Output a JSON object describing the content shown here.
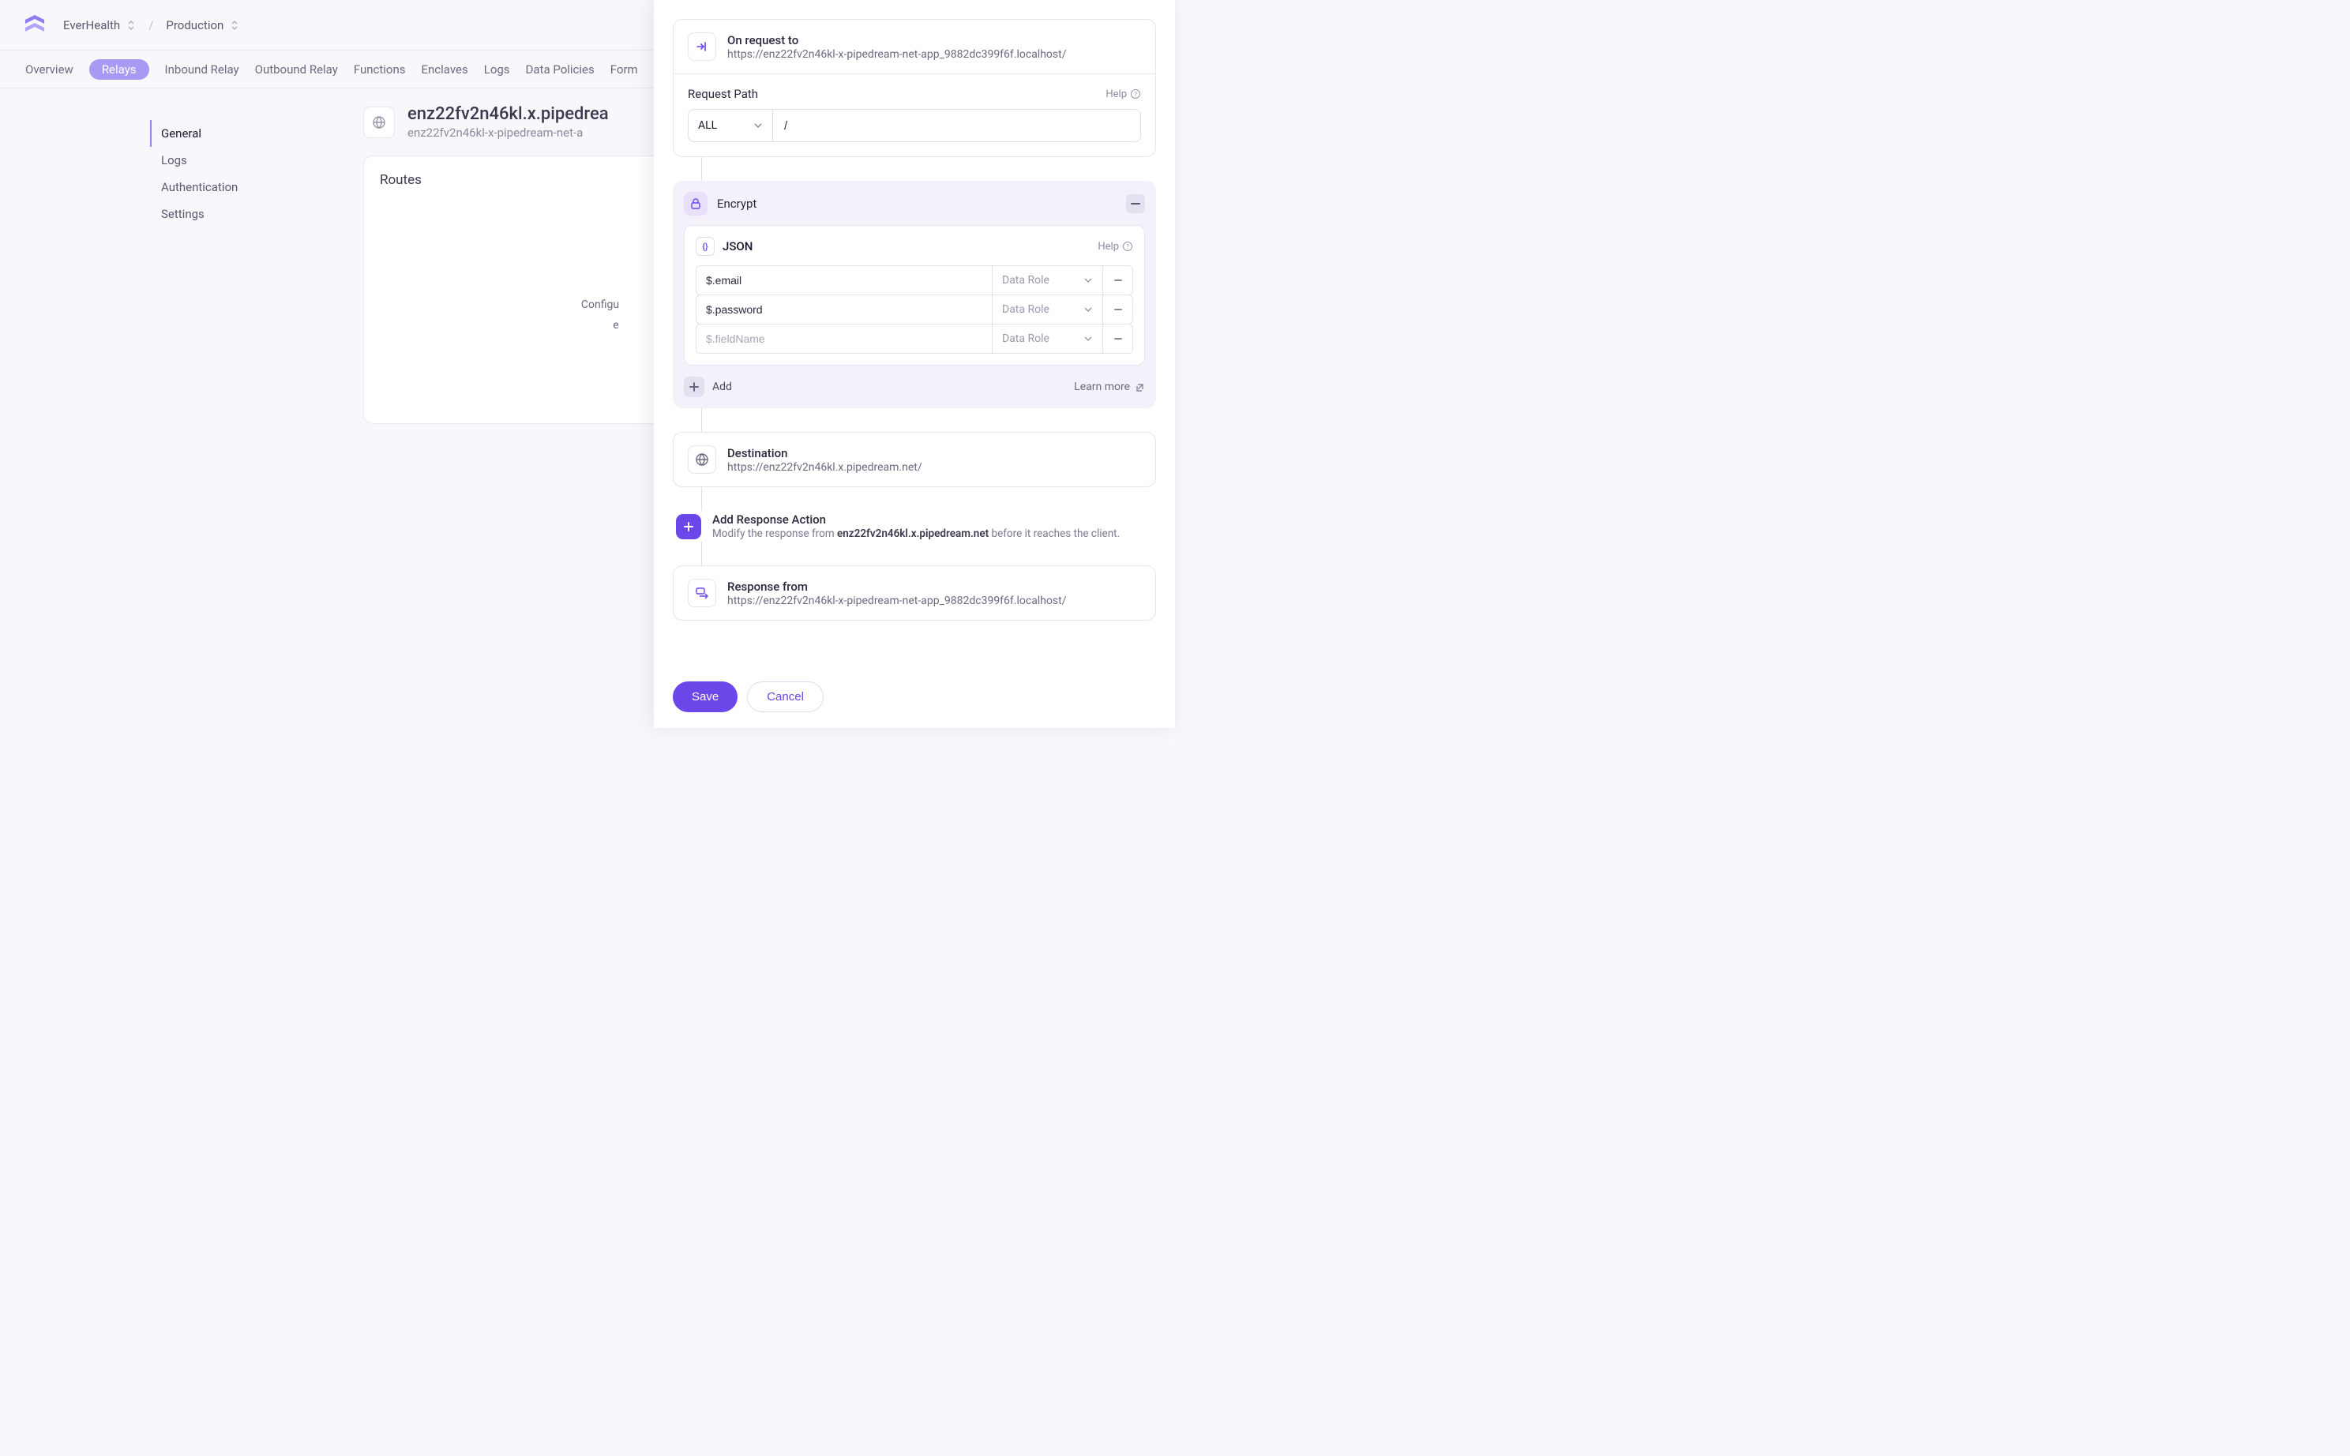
{
  "breadcrumb": {
    "org": "EverHealth",
    "env": "Production"
  },
  "nav": {
    "tabs": [
      "Overview",
      "Relays",
      "Inbound Relay",
      "Outbound Relay",
      "Functions",
      "Enclaves",
      "Logs",
      "Data Policies",
      "Form"
    ],
    "active": "Relays"
  },
  "sidebar": {
    "items": [
      "General",
      "Logs",
      "Authentication",
      "Settings"
    ],
    "active": "General"
  },
  "page": {
    "title": "enz22fv2n46kl.x.pipedrea",
    "subtitle": "enz22fv2n46kl-x-pipedream-net-a",
    "routes_title": "Routes",
    "routes_body_l1": "Configu",
    "routes_body_l2": "e"
  },
  "drawer": {
    "request": {
      "title": "On request to",
      "url": "https://enz22fv2n46kl-x-pipedream-net-app_9882dc399f6f.localhost/",
      "path_label": "Request Path",
      "help": "Help",
      "method": "ALL",
      "path_value": "/"
    },
    "encrypt": {
      "title": "Encrypt",
      "json_title": "JSON",
      "help": "Help",
      "fields": [
        {
          "value": "$.email",
          "role_ph": "Data Role"
        },
        {
          "value": "$.password",
          "role_ph": "Data Role"
        },
        {
          "value": "",
          "placeholder": "$.fieldName",
          "role_ph": "Data Role"
        }
      ],
      "add_label": "Add",
      "learn_more": "Learn more"
    },
    "destination": {
      "title": "Destination",
      "url": "https://enz22fv2n46kl.x.pipedream.net/"
    },
    "response_action": {
      "title": "Add Response Action",
      "prefix": "Modify the response from ",
      "host": "enz22fv2n46kl.x.pipedream.net",
      "suffix": " before it reaches the client."
    },
    "response_from": {
      "title": "Response from",
      "url": "https://enz22fv2n46kl-x-pipedream-net-app_9882dc399f6f.localhost/"
    },
    "footer": {
      "save": "Save",
      "cancel": "Cancel"
    }
  }
}
